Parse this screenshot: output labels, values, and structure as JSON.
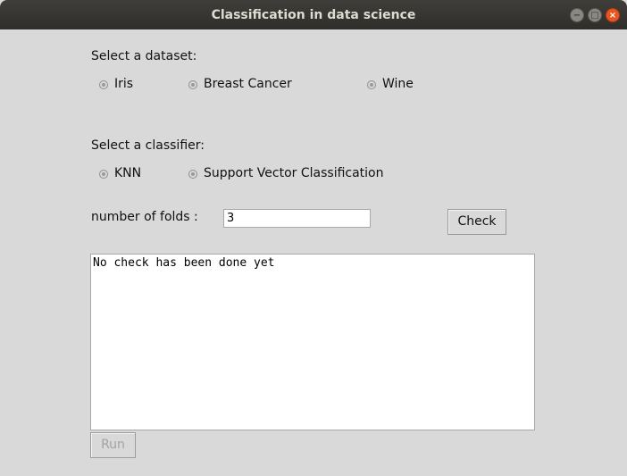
{
  "window": {
    "title": "Classification in data science",
    "controls": {
      "minimize": "−",
      "maximize": "□",
      "close": "×"
    }
  },
  "dataset": {
    "label": "Select a dataset:",
    "options": [
      "Iris",
      "Breast Cancer",
      "Wine"
    ]
  },
  "classifier": {
    "label": "Select a classifier:",
    "options": [
      "KNN",
      "Support Vector Classification"
    ]
  },
  "folds": {
    "label": "number of folds :",
    "value": "3"
  },
  "buttons": {
    "check": "Check",
    "run": "Run"
  },
  "output": {
    "text": "No check has been done yet"
  },
  "colors": {
    "background": "#d9d9d9",
    "titlebar": "#3c3b37",
    "close_button": "#e95420"
  }
}
